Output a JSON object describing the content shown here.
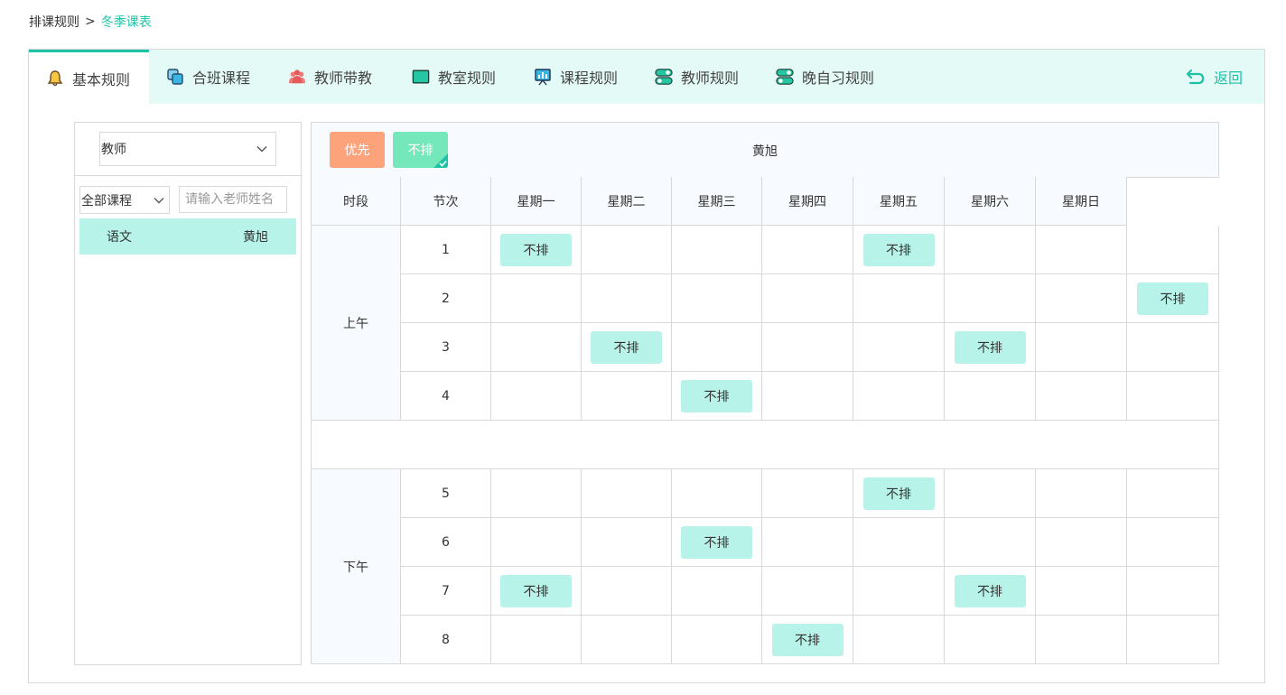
{
  "breadcrumb": {
    "parent": "排课规则",
    "separator": ">",
    "current": "冬季课表"
  },
  "tabs": [
    {
      "label": "基本规则",
      "icon": "bell-icon"
    },
    {
      "label": "合班课程",
      "icon": "layers-icon"
    },
    {
      "label": "教师带教",
      "icon": "users-icon"
    },
    {
      "label": "教室规则",
      "icon": "classroom-icon"
    },
    {
      "label": "课程规则",
      "icon": "presentation-chart-icon"
    },
    {
      "label": "教师规则",
      "icon": "toggle-icon"
    },
    {
      "label": "晚自习规则",
      "icon": "toggle-icon"
    }
  ],
  "active_tab": "基本规则",
  "back_label": "返回",
  "left": {
    "type_select": "教师",
    "course_select": "全部课程",
    "name_placeholder": "请输入老师姓名",
    "rows": [
      {
        "course": "语文",
        "teacher": "黄旭"
      }
    ]
  },
  "right": {
    "priority_label": "优先",
    "no_schedule_label": "不排",
    "teacher_name": "黄旭",
    "headers": [
      "时段",
      "节次",
      "星期一",
      "星期二",
      "星期三",
      "星期四",
      "星期五",
      "星期六",
      "星期日"
    ],
    "sections": [
      {
        "name": "上午",
        "periods": [
          "1",
          "2",
          "3",
          "4"
        ]
      },
      {
        "name": "下午",
        "periods": [
          "5",
          "6",
          "7",
          "8"
        ]
      }
    ],
    "badge_text": "不排",
    "marks": [
      {
        "period": "1",
        "col": 1
      },
      {
        "period": "1",
        "col": 5
      },
      {
        "period": "2",
        "col": 8
      },
      {
        "period": "3",
        "col": 2
      },
      {
        "period": "3",
        "col": 6
      },
      {
        "period": "4",
        "col": 3
      },
      {
        "period": "5",
        "col": 5
      },
      {
        "period": "6",
        "col": 3
      },
      {
        "period": "7",
        "col": 1
      },
      {
        "period": "7",
        "col": 6
      },
      {
        "period": "8",
        "col": 4
      }
    ]
  },
  "colors": {
    "accent": "#1ec3a6",
    "tab_bg": "#e4faf7",
    "badge_bg": "#b7f3e8",
    "priority": "#fca37c",
    "no_schedule": "#74e8ba"
  }
}
